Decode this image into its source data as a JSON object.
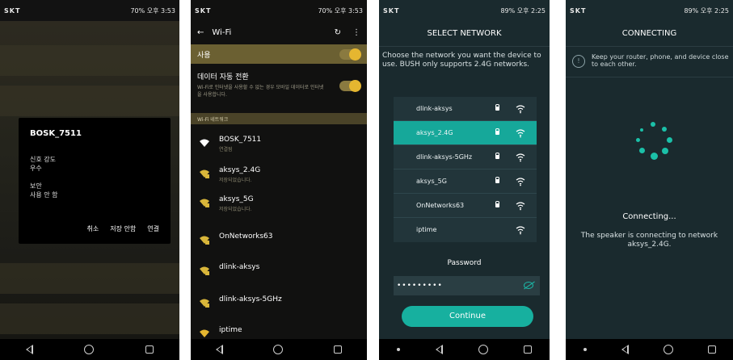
{
  "panel1": {
    "status": {
      "left": "SKT",
      "right": "70% 오후 3:53"
    },
    "dialog": {
      "title": "BOSK_7511",
      "signal_label": "신호 강도",
      "signal_value": "우수",
      "security_label": "보안",
      "security_value": "사용 안 함",
      "btn_cancel": "취소",
      "btn_dont_save": "저장 안함",
      "btn_connect": "연결"
    }
  },
  "panel2": {
    "status": {
      "left": "SKT",
      "right": "70% 오후 3:53"
    },
    "appbar_title": "Wi-Fi",
    "use_label": "사용",
    "auto_switch_title": "데이터 자동 전환",
    "auto_switch_desc": "Wi-Fi로 인터넷을 사용할 수 없는 경우 모바일 데이터로 인터넷을 사용합니다.",
    "section_label": "Wi-Fi 네트워크",
    "networks": [
      {
        "name": "BOSK_7511",
        "status": "연결됨"
      },
      {
        "name": "aksys_2.4G",
        "status": "저장되었습니다."
      },
      {
        "name": "aksys_5G",
        "status": "저장되었습니다."
      },
      {
        "name": "OnNetworks63",
        "status": ""
      },
      {
        "name": "dlink-aksys",
        "status": ""
      },
      {
        "name": "dlink-aksys-5GHz",
        "status": ""
      },
      {
        "name": "iptime",
        "status": ""
      }
    ]
  },
  "panel3": {
    "status": {
      "left": "SKT",
      "right": "89% 오후 2:25"
    },
    "header": "SELECT NETWORK",
    "description": "Choose the network you want the device to use. BUSH only supports 2.4G networks.",
    "networks": [
      {
        "name": "dlink-aksys",
        "locked": true,
        "selected": false
      },
      {
        "name": "aksys_2.4G",
        "locked": true,
        "selected": true
      },
      {
        "name": "dlink-aksys-5GHz",
        "locked": true,
        "selected": false
      },
      {
        "name": "aksys_5G",
        "locked": true,
        "selected": false
      },
      {
        "name": "OnNetworks63",
        "locked": true,
        "selected": false
      },
      {
        "name": "iptime",
        "locked": false,
        "selected": false
      }
    ],
    "password_label": "Password",
    "password_value": "•••••••••",
    "continue_label": "Continue"
  },
  "panel4": {
    "status": {
      "left": "SKT",
      "right": "89% 오후 2:25"
    },
    "header": "CONNECTING",
    "tip": "Keep your router, phone, and device close to each other.",
    "connecting_title": "Connecting...",
    "connecting_desc": "The speaker is connecting to network aksys_2.4G."
  },
  "colors": {
    "gold_accent": "#e5b630",
    "teal_accent": "#16a89a",
    "dark_teal_bg": "#1a2a2e"
  }
}
